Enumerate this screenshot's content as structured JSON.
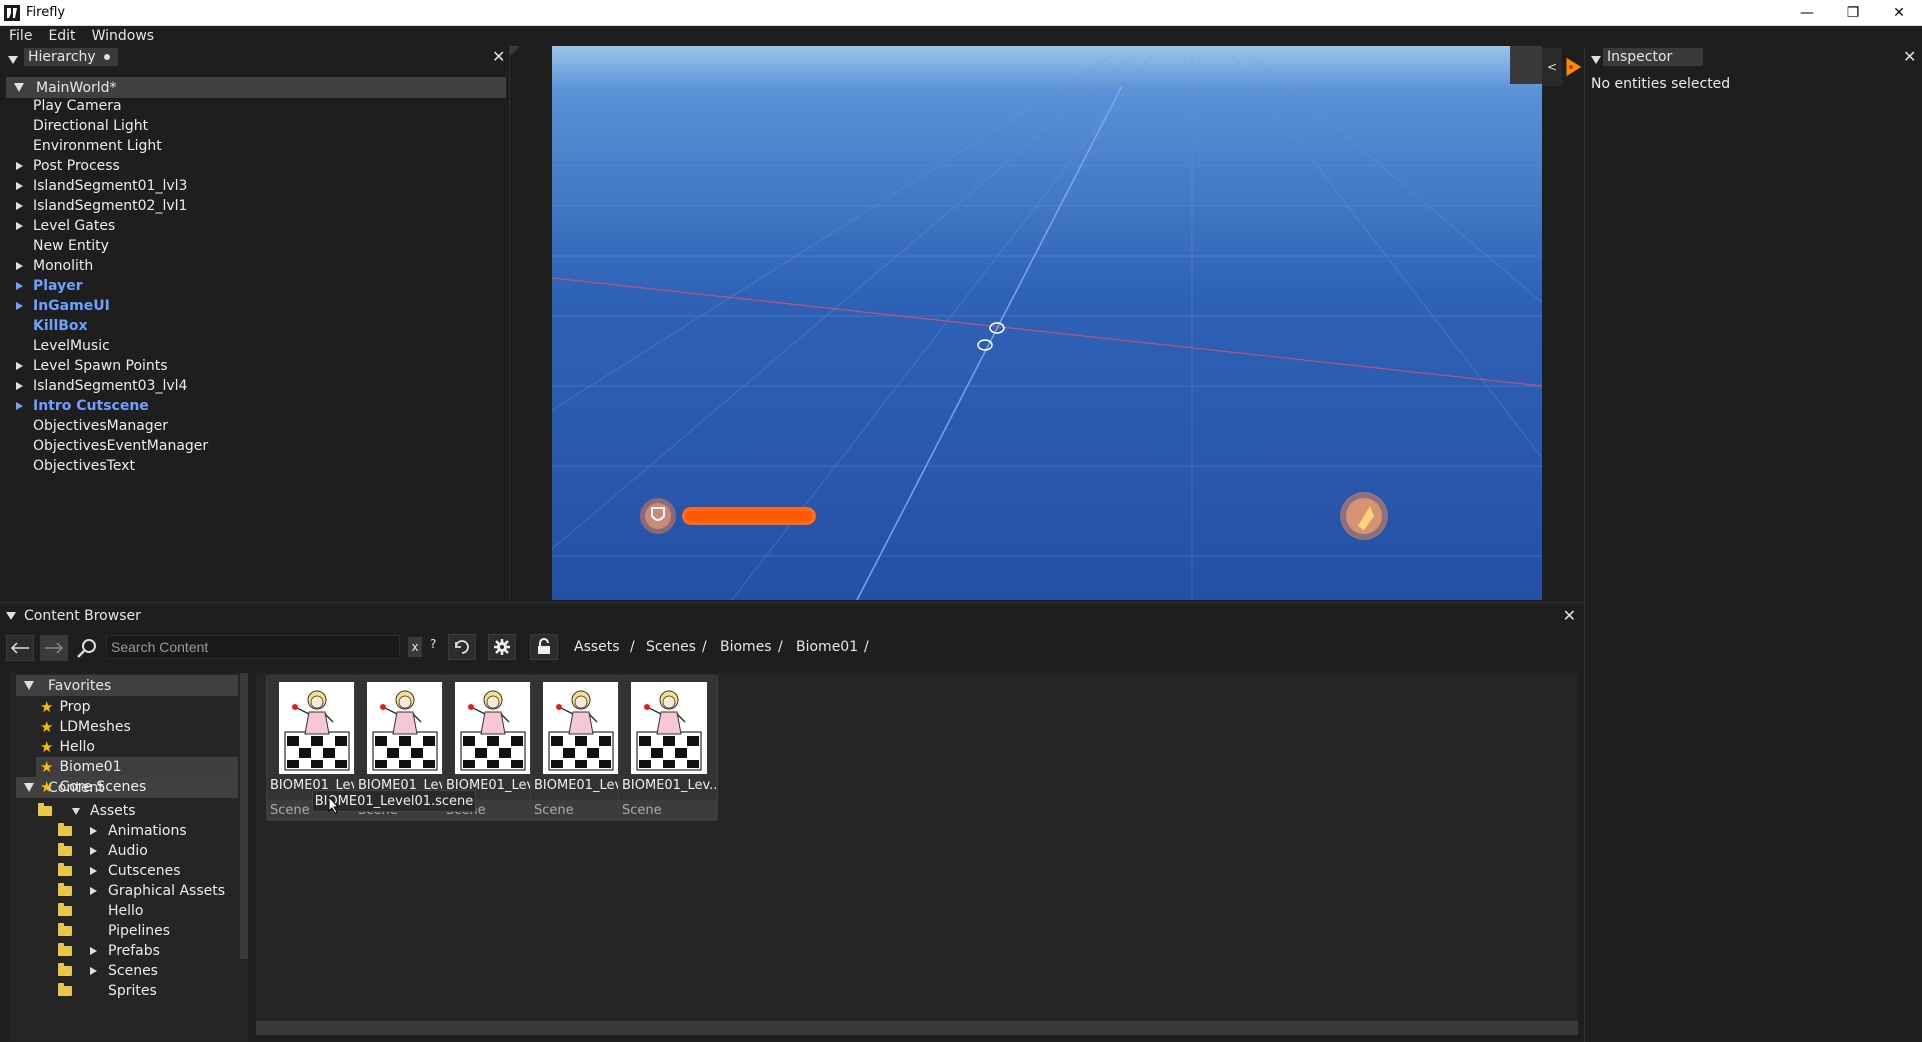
{
  "window": {
    "title": "Firefly",
    "minimize": "—",
    "restore": "❐",
    "close": "✕"
  },
  "menu": [
    "File",
    "Edit",
    "Windows"
  ],
  "hierarchy": {
    "tab_label": "Hierarchy",
    "root": "MainWorld*",
    "items": [
      {
        "label": "Play Camera",
        "expandable": false,
        "prefab": false
      },
      {
        "label": "Directional Light",
        "expandable": false,
        "prefab": false
      },
      {
        "label": "Environment Light",
        "expandable": false,
        "prefab": false
      },
      {
        "label": "Post Process",
        "expandable": true,
        "prefab": false
      },
      {
        "label": "IslandSegment01_lvl3",
        "expandable": true,
        "prefab": false
      },
      {
        "label": "IslandSegment02_lvl1",
        "expandable": true,
        "prefab": false
      },
      {
        "label": "Level Gates",
        "expandable": true,
        "prefab": false
      },
      {
        "label": "New Entity",
        "expandable": false,
        "prefab": false
      },
      {
        "label": "Monolith",
        "expandable": true,
        "prefab": false
      },
      {
        "label": "Player",
        "expandable": true,
        "prefab": true
      },
      {
        "label": "InGameUI",
        "expandable": true,
        "prefab": true
      },
      {
        "label": "KillBox",
        "expandable": false,
        "prefab": true
      },
      {
        "label": "LevelMusic",
        "expandable": false,
        "prefab": false
      },
      {
        "label": "Level Spawn Points",
        "expandable": true,
        "prefab": false
      },
      {
        "label": "IslandSegment03_lvl4",
        "expandable": true,
        "prefab": false
      },
      {
        "label": "Intro Cutscene",
        "expandable": true,
        "prefab": true
      },
      {
        "label": "ObjectivesManager",
        "expandable": false,
        "prefab": false
      },
      {
        "label": "ObjectivesEventManager",
        "expandable": false,
        "prefab": false
      },
      {
        "label": "ObjectivesText",
        "expandable": false,
        "prefab": false
      }
    ]
  },
  "viewport": {
    "collapse_label": "<",
    "accent_color": "#ff8a00"
  },
  "inspector": {
    "tab_label": "Inspector",
    "empty_message": "No entities selected"
  },
  "content_browser": {
    "title": "Content Browser",
    "search_placeholder": "Search Content",
    "clear_label": "x",
    "help_label": "?",
    "breadcrumb": [
      "Assets",
      "Scenes",
      "Biomes",
      "Biome01"
    ],
    "breadcrumb_sep": "/",
    "favorites_header": "Favorites",
    "favorites": [
      "Prop",
      "LDMeshes",
      "Hello",
      "Biome01",
      "Core Scenes"
    ],
    "selected_favorite": "Biome01",
    "content_header": "Content",
    "tree": [
      {
        "label": "Assets",
        "depth": 0,
        "state": "open"
      },
      {
        "label": "Animations",
        "depth": 1,
        "state": "closed"
      },
      {
        "label": "Audio",
        "depth": 1,
        "state": "closed"
      },
      {
        "label": "Cutscenes",
        "depth": 1,
        "state": "closed"
      },
      {
        "label": "Graphical Assets",
        "depth": 1,
        "state": "closed"
      },
      {
        "label": "Hello",
        "depth": 1,
        "state": "leaf"
      },
      {
        "label": "Pipelines",
        "depth": 1,
        "state": "leaf"
      },
      {
        "label": "Prefabs",
        "depth": 1,
        "state": "closed"
      },
      {
        "label": "Scenes",
        "depth": 1,
        "state": "closed"
      },
      {
        "label": "Sprites",
        "depth": 1,
        "state": "leaf"
      }
    ],
    "assets": [
      {
        "name": "BIOME01_Lev...",
        "type": "Scene"
      },
      {
        "name": "BIOME01_Lev...",
        "type": "Scene"
      },
      {
        "name": "BIOME01_Lev...",
        "type": "Scene"
      },
      {
        "name": "BIOME01_Lev...",
        "type": "Scene"
      },
      {
        "name": "BIOME01_Lev...",
        "type": "Scene"
      }
    ],
    "tooltip": "BIOME01_Level01.scene"
  }
}
